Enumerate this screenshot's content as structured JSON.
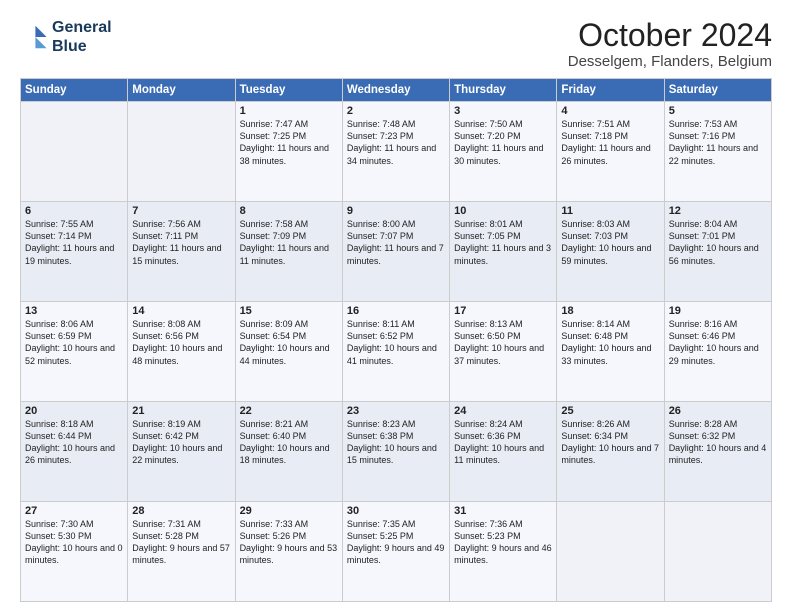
{
  "header": {
    "logo_line1": "General",
    "logo_line2": "Blue",
    "month": "October 2024",
    "location": "Desselgem, Flanders, Belgium"
  },
  "days_of_week": [
    "Sunday",
    "Monday",
    "Tuesday",
    "Wednesday",
    "Thursday",
    "Friday",
    "Saturday"
  ],
  "weeks": [
    [
      {
        "day": "",
        "info": ""
      },
      {
        "day": "",
        "info": ""
      },
      {
        "day": "1",
        "info": "Sunrise: 7:47 AM\nSunset: 7:25 PM\nDaylight: 11 hours and 38 minutes."
      },
      {
        "day": "2",
        "info": "Sunrise: 7:48 AM\nSunset: 7:23 PM\nDaylight: 11 hours and 34 minutes."
      },
      {
        "day": "3",
        "info": "Sunrise: 7:50 AM\nSunset: 7:20 PM\nDaylight: 11 hours and 30 minutes."
      },
      {
        "day": "4",
        "info": "Sunrise: 7:51 AM\nSunset: 7:18 PM\nDaylight: 11 hours and 26 minutes."
      },
      {
        "day": "5",
        "info": "Sunrise: 7:53 AM\nSunset: 7:16 PM\nDaylight: 11 hours and 22 minutes."
      }
    ],
    [
      {
        "day": "6",
        "info": "Sunrise: 7:55 AM\nSunset: 7:14 PM\nDaylight: 11 hours and 19 minutes."
      },
      {
        "day": "7",
        "info": "Sunrise: 7:56 AM\nSunset: 7:11 PM\nDaylight: 11 hours and 15 minutes."
      },
      {
        "day": "8",
        "info": "Sunrise: 7:58 AM\nSunset: 7:09 PM\nDaylight: 11 hours and 11 minutes."
      },
      {
        "day": "9",
        "info": "Sunrise: 8:00 AM\nSunset: 7:07 PM\nDaylight: 11 hours and 7 minutes."
      },
      {
        "day": "10",
        "info": "Sunrise: 8:01 AM\nSunset: 7:05 PM\nDaylight: 11 hours and 3 minutes."
      },
      {
        "day": "11",
        "info": "Sunrise: 8:03 AM\nSunset: 7:03 PM\nDaylight: 10 hours and 59 minutes."
      },
      {
        "day": "12",
        "info": "Sunrise: 8:04 AM\nSunset: 7:01 PM\nDaylight: 10 hours and 56 minutes."
      }
    ],
    [
      {
        "day": "13",
        "info": "Sunrise: 8:06 AM\nSunset: 6:59 PM\nDaylight: 10 hours and 52 minutes."
      },
      {
        "day": "14",
        "info": "Sunrise: 8:08 AM\nSunset: 6:56 PM\nDaylight: 10 hours and 48 minutes."
      },
      {
        "day": "15",
        "info": "Sunrise: 8:09 AM\nSunset: 6:54 PM\nDaylight: 10 hours and 44 minutes."
      },
      {
        "day": "16",
        "info": "Sunrise: 8:11 AM\nSunset: 6:52 PM\nDaylight: 10 hours and 41 minutes."
      },
      {
        "day": "17",
        "info": "Sunrise: 8:13 AM\nSunset: 6:50 PM\nDaylight: 10 hours and 37 minutes."
      },
      {
        "day": "18",
        "info": "Sunrise: 8:14 AM\nSunset: 6:48 PM\nDaylight: 10 hours and 33 minutes."
      },
      {
        "day": "19",
        "info": "Sunrise: 8:16 AM\nSunset: 6:46 PM\nDaylight: 10 hours and 29 minutes."
      }
    ],
    [
      {
        "day": "20",
        "info": "Sunrise: 8:18 AM\nSunset: 6:44 PM\nDaylight: 10 hours and 26 minutes."
      },
      {
        "day": "21",
        "info": "Sunrise: 8:19 AM\nSunset: 6:42 PM\nDaylight: 10 hours and 22 minutes."
      },
      {
        "day": "22",
        "info": "Sunrise: 8:21 AM\nSunset: 6:40 PM\nDaylight: 10 hours and 18 minutes."
      },
      {
        "day": "23",
        "info": "Sunrise: 8:23 AM\nSunset: 6:38 PM\nDaylight: 10 hours and 15 minutes."
      },
      {
        "day": "24",
        "info": "Sunrise: 8:24 AM\nSunset: 6:36 PM\nDaylight: 10 hours and 11 minutes."
      },
      {
        "day": "25",
        "info": "Sunrise: 8:26 AM\nSunset: 6:34 PM\nDaylight: 10 hours and 7 minutes."
      },
      {
        "day": "26",
        "info": "Sunrise: 8:28 AM\nSunset: 6:32 PM\nDaylight: 10 hours and 4 minutes."
      }
    ],
    [
      {
        "day": "27",
        "info": "Sunrise: 7:30 AM\nSunset: 5:30 PM\nDaylight: 10 hours and 0 minutes."
      },
      {
        "day": "28",
        "info": "Sunrise: 7:31 AM\nSunset: 5:28 PM\nDaylight: 9 hours and 57 minutes."
      },
      {
        "day": "29",
        "info": "Sunrise: 7:33 AM\nSunset: 5:26 PM\nDaylight: 9 hours and 53 minutes."
      },
      {
        "day": "30",
        "info": "Sunrise: 7:35 AM\nSunset: 5:25 PM\nDaylight: 9 hours and 49 minutes."
      },
      {
        "day": "31",
        "info": "Sunrise: 7:36 AM\nSunset: 5:23 PM\nDaylight: 9 hours and 46 minutes."
      },
      {
        "day": "",
        "info": ""
      },
      {
        "day": "",
        "info": ""
      }
    ]
  ]
}
